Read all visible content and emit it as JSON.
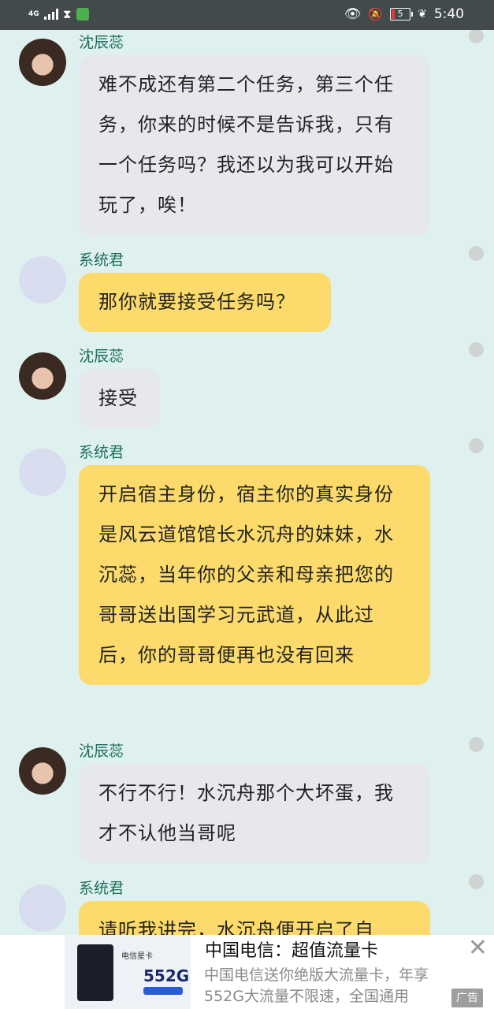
{
  "status_bar": {
    "network": "4G",
    "battery_level": "5",
    "time": "5:40"
  },
  "chat": {
    "messages": [
      {
        "sender": "沈辰蕊",
        "role": "user",
        "text": "难不成还有第二个任务，第三个任务，你来的时候不是告诉我，只有一个任务吗？我还以为我可以开始玩了，唉！"
      },
      {
        "sender": "系统君",
        "role": "system",
        "text": "那你就要接受任务吗？"
      },
      {
        "sender": "沈辰蕊",
        "role": "user",
        "text": "接受"
      },
      {
        "sender": "系统君",
        "role": "system",
        "text": "开启宿主身份，宿主你的真实身份是风云道馆馆长水沉舟的妹妹，水沉蕊，当年你的父亲和母亲把您的哥哥送出国学习元武道，从此过后，你的哥哥便再也没有回来"
      },
      {
        "sender": "沈辰蕊",
        "role": "user",
        "text": "不行不行！水沉舟那个大坏蛋，我才不认他当哥呢"
      },
      {
        "sender": "系统君",
        "role": "system",
        "text": "请听我讲完，水沉舟便开启了自"
      }
    ]
  },
  "ad": {
    "thumb_brand": "电信星卡",
    "thumb_number": "552G",
    "title": "中国电信：超值流量卡",
    "description": "中国电信送你绝版大流量卡，年享552G大流量不限速，全国通用",
    "badge": "广告",
    "close_icon": "close-icon"
  },
  "colors": {
    "background": "#dff1ef",
    "user_bubble": "#e6e8ee",
    "system_bubble": "#fcdb6c",
    "sender_name": "#1c6e5e"
  }
}
